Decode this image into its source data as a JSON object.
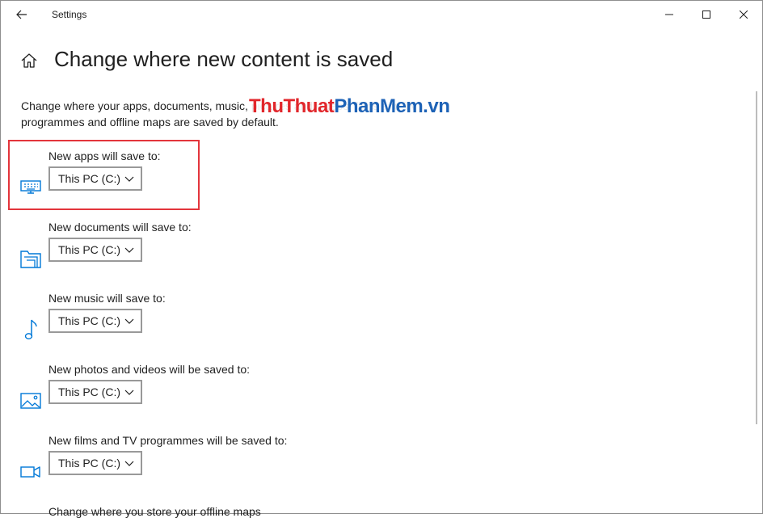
{
  "window": {
    "title": "Settings"
  },
  "header": {
    "title": "Change where new content is saved"
  },
  "description": "Change where your apps, documents, music, pictures and videos, films and TV programmes and offline maps are saved by default.",
  "watermark": {
    "part1": "ThuThuat",
    "part2": "PhanMem",
    "part3": ".vn"
  },
  "rows": [
    {
      "label": "New apps will save to:",
      "value": "This PC (C:)",
      "icon": "monitor-icon"
    },
    {
      "label": "New documents will save to:",
      "value": "This PC (C:)",
      "icon": "documents-folder-icon"
    },
    {
      "label": "New music will save to:",
      "value": "This PC (C:)",
      "icon": "music-note-icon"
    },
    {
      "label": "New photos and videos will be saved to:",
      "value": "This PC (C:)",
      "icon": "photo-icon"
    },
    {
      "label": "New films and TV programmes will be saved to:",
      "value": "This PC (C:)",
      "icon": "video-camera-icon"
    }
  ],
  "offline_maps_label": "Change where you store your offline maps",
  "colors": {
    "accent": "#0078d7",
    "highlight": "#e3353c",
    "watermark_red": "#e1262b",
    "watermark_blue": "#1d62b6"
  }
}
